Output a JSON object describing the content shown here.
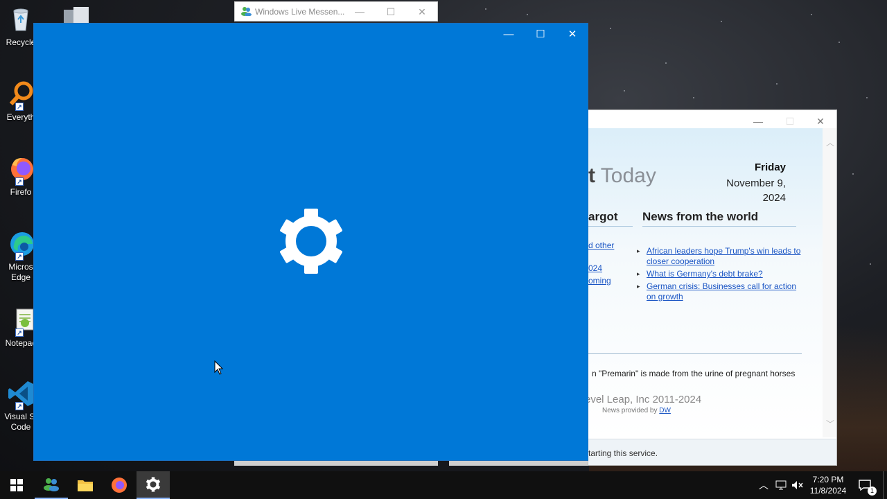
{
  "desktop": {
    "icons": [
      {
        "name": "recycle-bin",
        "label": "Recycle"
      },
      {
        "name": "everything",
        "label": "Everyth"
      },
      {
        "name": "firefox",
        "label": "Firefo"
      },
      {
        "name": "edge",
        "label": "Micros\nEdge"
      },
      {
        "name": "notepad",
        "label": "Notepac"
      },
      {
        "name": "vscode",
        "label": "Visual St\nCode"
      }
    ]
  },
  "messenger_window": {
    "title": "Windows Live Messen...",
    "icon": "messenger-icon"
  },
  "settings_window": {
    "background": "#0078d7",
    "icon": "gear-icon"
  },
  "news_window": {
    "heading_bold": "t",
    "heading_light": "Today",
    "day": "Friday",
    "date_line1": "November 9,",
    "date_line2": "2024",
    "argot_heading": "argot",
    "news_heading": "News from the world",
    "argot_links": [
      "d other",
      "024",
      "oming"
    ],
    "news_items": [
      "African leaders hope Trump's win leads to closer cooperation",
      "What is Germany's debt brake?",
      "German crisis: Businesses call for action on growth"
    ],
    "fact": "n \"Premarin\" is made from the urine of pregnant horses",
    "copyright": "evel Leap, Inc 2011-2024",
    "provided_prefix": "News provided by",
    "provided_link": "DW",
    "status": "tarting this service."
  },
  "taskbar": {
    "items": [
      "start-button",
      "messenger",
      "file-explorer",
      "firefox",
      "settings"
    ],
    "clock_time": "7:20 PM",
    "clock_date": "11/8/2024",
    "notification_count": "1"
  },
  "colors": {
    "settings_blue": "#0078d7",
    "link_blue": "#1a55c4",
    "taskbar": "#101010"
  }
}
